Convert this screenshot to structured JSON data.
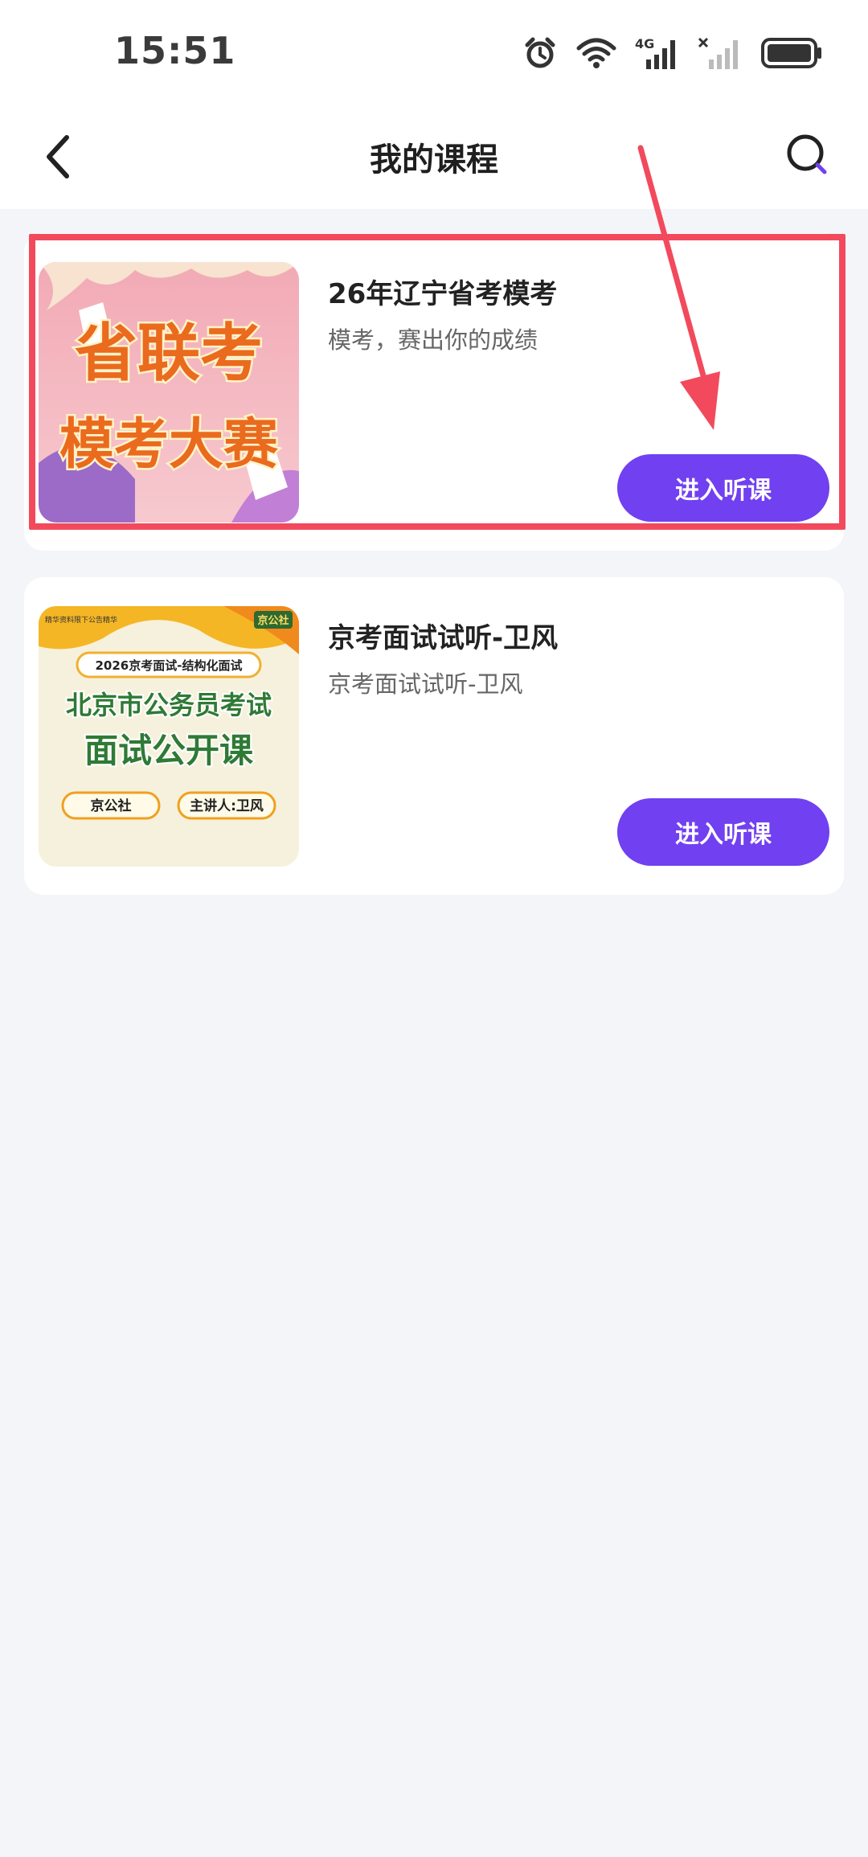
{
  "status_bar": {
    "time": "15:51",
    "network_label": "4G",
    "icons": [
      "alarm-icon",
      "wifi-icon",
      "signal-4g-icon",
      "signal-no-sim-icon",
      "battery-icon"
    ]
  },
  "nav": {
    "title": "我的课程",
    "back_icon": "chevron-left-icon",
    "search_icon": "search-icon"
  },
  "courses": [
    {
      "title": "26年辽宁省考模考",
      "subtitle": "模考，赛出你的成绩",
      "button_label": "进入听课",
      "thumbnail_text": [
        "省联考",
        "模考大赛"
      ]
    },
    {
      "title": "京考面试试听-卫风",
      "subtitle": "京考面试试听-卫风",
      "button_label": "进入听课",
      "thumbnail_text": {
        "top_small": "精华资料限下公告精华",
        "brand": "京公社",
        "banner": "2026京考面试-结构化面试",
        "line1": "北京市公务员考试",
        "line2": "面试公开课",
        "tag_left": "京公社",
        "tag_right": "主讲人:卫风"
      }
    }
  ],
  "colors": {
    "accent": "#7140f0",
    "highlight": "#f24a5c",
    "background": "#f4f5f9"
  }
}
